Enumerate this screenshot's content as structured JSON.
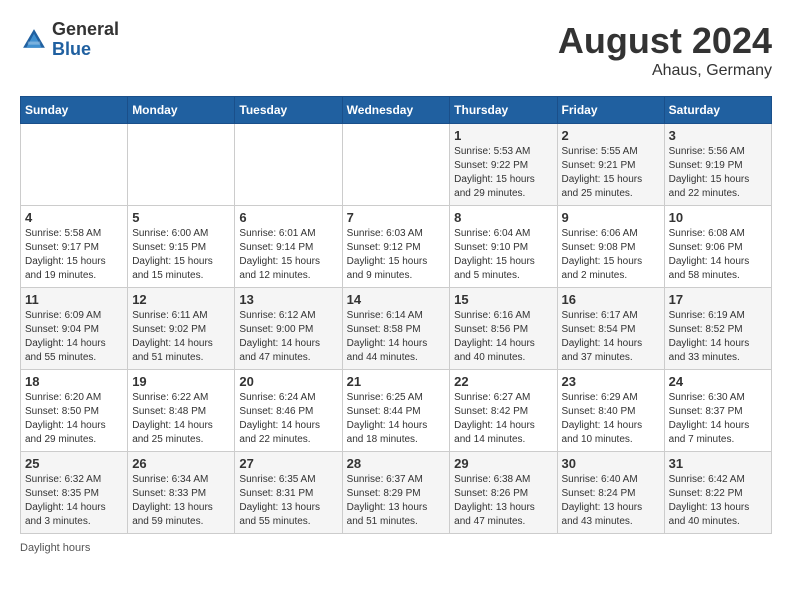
{
  "header": {
    "logo_general": "General",
    "logo_blue": "Blue",
    "month_title": "August 2024",
    "location": "Ahaus, Germany"
  },
  "days_of_week": [
    "Sunday",
    "Monday",
    "Tuesday",
    "Wednesday",
    "Thursday",
    "Friday",
    "Saturday"
  ],
  "footer": {
    "daylight_hours": "Daylight hours"
  },
  "weeks": [
    {
      "days": [
        {
          "num": "",
          "info": ""
        },
        {
          "num": "",
          "info": ""
        },
        {
          "num": "",
          "info": ""
        },
        {
          "num": "",
          "info": ""
        },
        {
          "num": "1",
          "info": "Sunrise: 5:53 AM\nSunset: 9:22 PM\nDaylight: 15 hours\nand 29 minutes."
        },
        {
          "num": "2",
          "info": "Sunrise: 5:55 AM\nSunset: 9:21 PM\nDaylight: 15 hours\nand 25 minutes."
        },
        {
          "num": "3",
          "info": "Sunrise: 5:56 AM\nSunset: 9:19 PM\nDaylight: 15 hours\nand 22 minutes."
        }
      ]
    },
    {
      "days": [
        {
          "num": "4",
          "info": "Sunrise: 5:58 AM\nSunset: 9:17 PM\nDaylight: 15 hours\nand 19 minutes."
        },
        {
          "num": "5",
          "info": "Sunrise: 6:00 AM\nSunset: 9:15 PM\nDaylight: 15 hours\nand 15 minutes."
        },
        {
          "num": "6",
          "info": "Sunrise: 6:01 AM\nSunset: 9:14 PM\nDaylight: 15 hours\nand 12 minutes."
        },
        {
          "num": "7",
          "info": "Sunrise: 6:03 AM\nSunset: 9:12 PM\nDaylight: 15 hours\nand 9 minutes."
        },
        {
          "num": "8",
          "info": "Sunrise: 6:04 AM\nSunset: 9:10 PM\nDaylight: 15 hours\nand 5 minutes."
        },
        {
          "num": "9",
          "info": "Sunrise: 6:06 AM\nSunset: 9:08 PM\nDaylight: 15 hours\nand 2 minutes."
        },
        {
          "num": "10",
          "info": "Sunrise: 6:08 AM\nSunset: 9:06 PM\nDaylight: 14 hours\nand 58 minutes."
        }
      ]
    },
    {
      "days": [
        {
          "num": "11",
          "info": "Sunrise: 6:09 AM\nSunset: 9:04 PM\nDaylight: 14 hours\nand 55 minutes."
        },
        {
          "num": "12",
          "info": "Sunrise: 6:11 AM\nSunset: 9:02 PM\nDaylight: 14 hours\nand 51 minutes."
        },
        {
          "num": "13",
          "info": "Sunrise: 6:12 AM\nSunset: 9:00 PM\nDaylight: 14 hours\nand 47 minutes."
        },
        {
          "num": "14",
          "info": "Sunrise: 6:14 AM\nSunset: 8:58 PM\nDaylight: 14 hours\nand 44 minutes."
        },
        {
          "num": "15",
          "info": "Sunrise: 6:16 AM\nSunset: 8:56 PM\nDaylight: 14 hours\nand 40 minutes."
        },
        {
          "num": "16",
          "info": "Sunrise: 6:17 AM\nSunset: 8:54 PM\nDaylight: 14 hours\nand 37 minutes."
        },
        {
          "num": "17",
          "info": "Sunrise: 6:19 AM\nSunset: 8:52 PM\nDaylight: 14 hours\nand 33 minutes."
        }
      ]
    },
    {
      "days": [
        {
          "num": "18",
          "info": "Sunrise: 6:20 AM\nSunset: 8:50 PM\nDaylight: 14 hours\nand 29 minutes."
        },
        {
          "num": "19",
          "info": "Sunrise: 6:22 AM\nSunset: 8:48 PM\nDaylight: 14 hours\nand 25 minutes."
        },
        {
          "num": "20",
          "info": "Sunrise: 6:24 AM\nSunset: 8:46 PM\nDaylight: 14 hours\nand 22 minutes."
        },
        {
          "num": "21",
          "info": "Sunrise: 6:25 AM\nSunset: 8:44 PM\nDaylight: 14 hours\nand 18 minutes."
        },
        {
          "num": "22",
          "info": "Sunrise: 6:27 AM\nSunset: 8:42 PM\nDaylight: 14 hours\nand 14 minutes."
        },
        {
          "num": "23",
          "info": "Sunrise: 6:29 AM\nSunset: 8:40 PM\nDaylight: 14 hours\nand 10 minutes."
        },
        {
          "num": "24",
          "info": "Sunrise: 6:30 AM\nSunset: 8:37 PM\nDaylight: 14 hours\nand 7 minutes."
        }
      ]
    },
    {
      "days": [
        {
          "num": "25",
          "info": "Sunrise: 6:32 AM\nSunset: 8:35 PM\nDaylight: 14 hours\nand 3 minutes."
        },
        {
          "num": "26",
          "info": "Sunrise: 6:34 AM\nSunset: 8:33 PM\nDaylight: 13 hours\nand 59 minutes."
        },
        {
          "num": "27",
          "info": "Sunrise: 6:35 AM\nSunset: 8:31 PM\nDaylight: 13 hours\nand 55 minutes."
        },
        {
          "num": "28",
          "info": "Sunrise: 6:37 AM\nSunset: 8:29 PM\nDaylight: 13 hours\nand 51 minutes."
        },
        {
          "num": "29",
          "info": "Sunrise: 6:38 AM\nSunset: 8:26 PM\nDaylight: 13 hours\nand 47 minutes."
        },
        {
          "num": "30",
          "info": "Sunrise: 6:40 AM\nSunset: 8:24 PM\nDaylight: 13 hours\nand 43 minutes."
        },
        {
          "num": "31",
          "info": "Sunrise: 6:42 AM\nSunset: 8:22 PM\nDaylight: 13 hours\nand 40 minutes."
        }
      ]
    }
  ]
}
